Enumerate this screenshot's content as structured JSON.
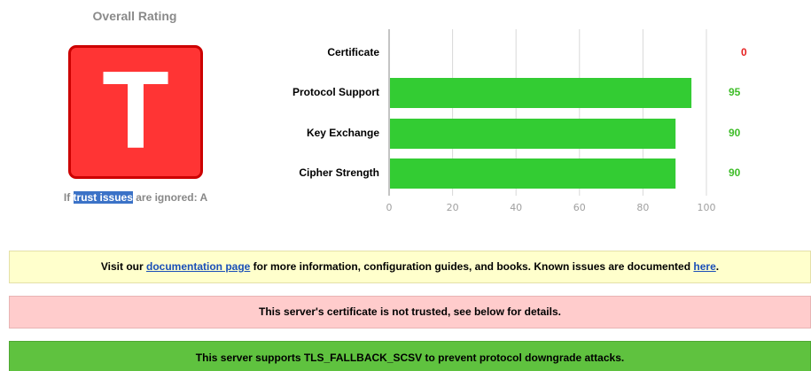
{
  "rating": {
    "title": "Overall Rating",
    "grade": "T",
    "note_prefix": "If ",
    "note_highlight": "trust issues",
    "note_suffix": " are ignored: A",
    "grade_color": "#ff3434"
  },
  "chart_data": {
    "type": "bar",
    "orientation": "horizontal",
    "categories": [
      "Certificate",
      "Protocol Support",
      "Key Exchange",
      "Cipher Strength"
    ],
    "values": [
      0,
      95,
      90,
      90
    ],
    "score_labels": [
      "0",
      "95",
      "90",
      "90"
    ],
    "score_colors": [
      "#e62020",
      "#3fbd29",
      "#3fbd29",
      "#3fbd29"
    ],
    "bar_color": "#33cc33",
    "xlim": [
      0,
      100
    ],
    "xticks": [
      "0",
      "20",
      "40",
      "60",
      "80",
      "100"
    ],
    "grid": true
  },
  "notices": {
    "info_prefix": "Visit our ",
    "info_link1": "documentation page",
    "info_middle": " for more information, configuration guides, and books. Known issues are documented ",
    "info_link2": "here",
    "info_suffix": ".",
    "warning": "This server's certificate is not trusted, see below for details.",
    "success": "This server supports TLS_FALLBACK_SCSV to prevent protocol downgrade attacks."
  }
}
